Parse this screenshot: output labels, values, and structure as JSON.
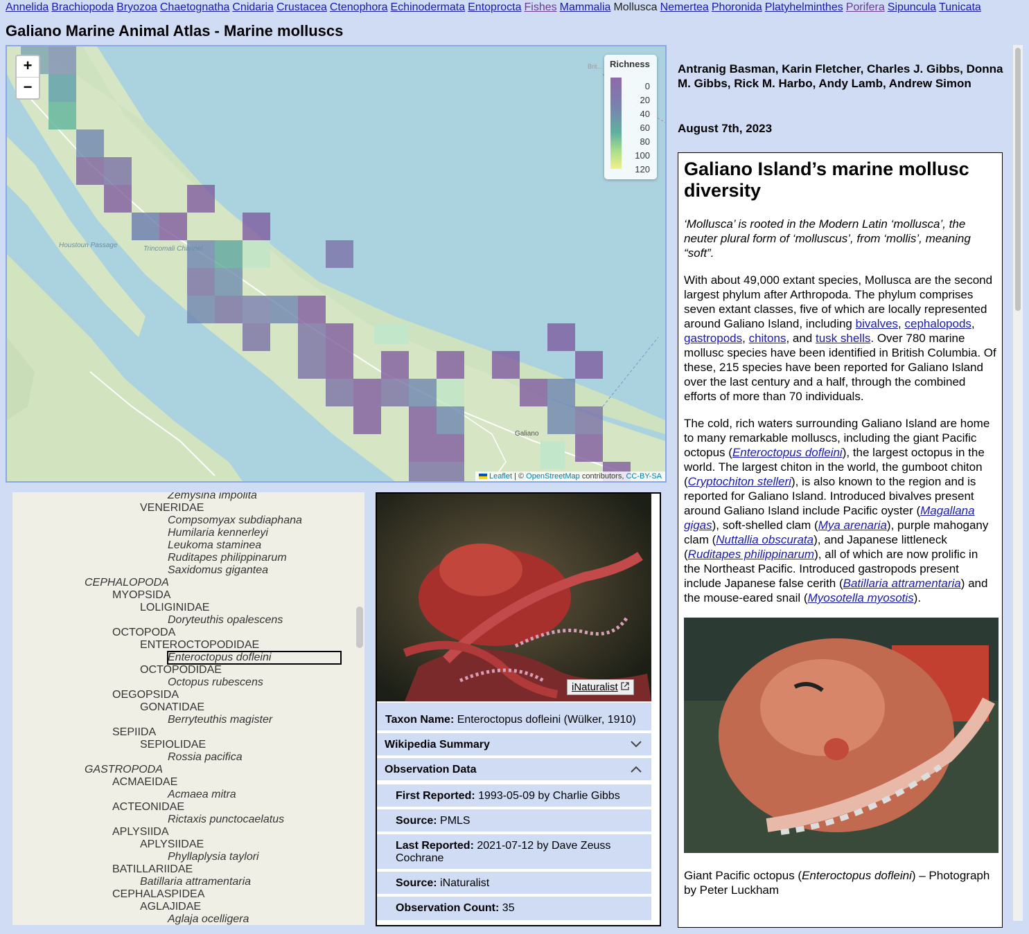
{
  "nav": {
    "phyla": [
      {
        "label": "Annelida",
        "state": "link"
      },
      {
        "label": "Brachiopoda",
        "state": "link"
      },
      {
        "label": "Bryozoa",
        "state": "link"
      },
      {
        "label": "Chaetognatha",
        "state": "link"
      },
      {
        "label": "Cnidaria",
        "state": "link"
      },
      {
        "label": "Crustacea",
        "state": "link"
      },
      {
        "label": "Ctenophora",
        "state": "link"
      },
      {
        "label": "Echinodermata",
        "state": "link"
      },
      {
        "label": "Entoprocta",
        "state": "link"
      },
      {
        "label": "Fishes",
        "state": "visited"
      },
      {
        "label": "Mammalia",
        "state": "link"
      },
      {
        "label": "Mollusca",
        "state": "current"
      },
      {
        "label": "Nemertea",
        "state": "link"
      },
      {
        "label": "Phoronida",
        "state": "link"
      },
      {
        "label": "Platyhelminthes",
        "state": "link"
      },
      {
        "label": "Porifera",
        "state": "visited"
      },
      {
        "label": "Sipuncula",
        "state": "link"
      },
      {
        "label": "Tunicata",
        "state": "link"
      }
    ]
  },
  "page": {
    "title": "Galiano Marine Animal Atlas - Marine molluscs"
  },
  "map": {
    "zoom_in": "+",
    "zoom_out": "−",
    "legend": {
      "title": "Richness",
      "ticks": [
        "0",
        "20",
        "40",
        "60",
        "80",
        "100",
        "120"
      ]
    },
    "place_labels": [
      "Houstoun Passage",
      "Trincomali Channel",
      "Galiano",
      "Brit..."
    ],
    "attribution": {
      "leaflet": "Leaflet",
      "sep": " | © ",
      "osm": "OpenStreetMap",
      "contrib": " contributors, ",
      "license": "CC-BY-SA"
    }
  },
  "taxonomy": {
    "rows": [
      {
        "text": "Zemysina impolita",
        "style": "it"
      },
      {
        "text": "VENERIDAE",
        "style": "fam"
      },
      {
        "text": "Compsomyax subdiaphana",
        "style": "it"
      },
      {
        "text": "Humilaria kennerleyi",
        "style": "it"
      },
      {
        "text": "Leukoma staminea",
        "style": "it"
      },
      {
        "text": "Ruditapes philippinarum",
        "style": "it"
      },
      {
        "text": "Saxidomus gigantea",
        "style": "it"
      },
      {
        "text": "CEPHALOPODA",
        "style": "cls"
      },
      {
        "text": "MYOPSIDA",
        "style": "ord"
      },
      {
        "text": "LOLIGINIDAE",
        "style": "fam"
      },
      {
        "text": "Doryteuthis opalescens",
        "style": "it"
      },
      {
        "text": "OCTOPODA",
        "style": "ord"
      },
      {
        "text": "ENTEROCTOPODIDAE",
        "style": "fam"
      },
      {
        "text": "Enteroctopus dofleini",
        "style": "it",
        "selected": true
      },
      {
        "text": "OCTOPODIDAE",
        "style": "fam"
      },
      {
        "text": "Octopus rubescens",
        "style": "it"
      },
      {
        "text": "OEGOPSIDA",
        "style": "ord"
      },
      {
        "text": "GONATIDAE",
        "style": "fam"
      },
      {
        "text": "Berryteuthis magister",
        "style": "it"
      },
      {
        "text": "SEPIIDA",
        "style": "ord"
      },
      {
        "text": "SEPIOLIDAE",
        "style": "fam"
      },
      {
        "text": "Rossia pacifica",
        "style": "it"
      },
      {
        "text": "GASTROPODA",
        "style": "cls"
      },
      {
        "text": "ACMAEIDAE",
        "style": "ord"
      },
      {
        "text": "Acmaea mitra",
        "style": "it"
      },
      {
        "text": "ACTEONIDAE",
        "style": "ord"
      },
      {
        "text": "Rictaxis punctocaelatus",
        "style": "it"
      },
      {
        "text": "APLYSIIDA",
        "style": "ord"
      },
      {
        "text": "APLYSIIDAE",
        "style": "fam"
      },
      {
        "text": "Phyllaplysia taylori",
        "style": "it"
      },
      {
        "text": "BATILLARIIDAE",
        "style": "ord"
      },
      {
        "text": "Batillaria attramentaria",
        "style": "fam-it"
      },
      {
        "text": "CEPHALASPIDEA",
        "style": "ord"
      },
      {
        "text": "AGLAJIDAE",
        "style": "fam"
      },
      {
        "text": "Aglaja ocelligera",
        "style": "it"
      }
    ]
  },
  "taxon": {
    "inat_label": "iNaturalist",
    "name_label": "Taxon Name:",
    "name_value": "Enteroctopus dofleini (Wülker, 1910)",
    "wiki_label": "Wikipedia Summary",
    "obs_label": "Observation Data",
    "first_label": "First Reported:",
    "first_value": "1993-05-09 by Charlie Gibbs",
    "source1_label": "Source:",
    "source1_value": "PMLS",
    "last_label": "Last Reported:",
    "last_value": "2021-07-12 by Dave Zeuss Cochrane",
    "source2_label": "Source:",
    "source2_value": "iNaturalist",
    "count_label": "Observation Count:",
    "count_value": "35"
  },
  "essay": {
    "authors": "Antranig Basman, Karin Fletcher, Charles J. Gibbs, Donna M. Gibbs, Rick M. Harbo, Andy Lamb, Andrew Simon",
    "date": "August 7th, 2023",
    "heading": "Galiano Island’s marine mollusc diversity",
    "etymology": "‘Mollusca’ is rooted in the Modern Latin ‘mollusca’, the neuter plural form of ‘molluscus’, from ‘mollis’, meaning “soft”.",
    "p1_a": "With about 49,000 extant species, Mollusca are the second largest phylum after Arthropoda. The phylum comprises seven extant classes, five of which are locally represented around Galiano Island, including ",
    "l_bivalves": "bivalves",
    "l_cephalopods": "cephalopods",
    "l_gastropods": "gastropods",
    "l_chitons": "chitons",
    "and": ", and ",
    "l_tusk": "tusk shells",
    "p1_b": ". Over 780 marine mollusc species have been identified in British Columbia. Of these, 215 species have been reported for Galiano Island over the last century and a half, through the combined efforts of more than 70 individuals.",
    "p2_a": "The cold, rich waters surrounding Galiano Island are home to many remarkable molluscs, including the giant Pacific octopus (",
    "sp1": "Enteroctopus dofleini",
    "p2_b": "), the largest octopus in the world. The largest chiton in the world, the gumboot chiton (",
    "sp2": "Cryptochiton stelleri",
    "p2_c": "), is also known to the region and is reported for Galiano Island. Introduced bivalves present around Galiano Island include Pacific oyster (",
    "sp3": "Magallana gigas",
    "p2_d": "), soft-shelled clam (",
    "sp4": "Mya arenaria",
    "p2_e": "), purple mahogany clam (",
    "sp5": "Nuttallia obscurata",
    "p2_f": "), and Japanese littleneck (",
    "sp6": "Ruditapes philippinarum",
    "p2_g": "), all of which are now prolific in the Northeast Pacific. Introduced gastropods present include Japanese false cerith (",
    "sp7": "Batillaria attramentaria",
    "p2_h": ") and the mouse-eared snail (",
    "sp8": "Myosotella myosotis",
    "p2_i": ").",
    "caption_a": "Giant Pacific octopus (",
    "caption_sp": "Enteroctopus dofleini",
    "caption_b": ") – Photograph by Peter Luckham"
  },
  "colors": {
    "page_bg": "#cfdcf4",
    "map_border": "#8aa8e8",
    "link": "#1a1aa8",
    "visited": "#6a3a94"
  }
}
